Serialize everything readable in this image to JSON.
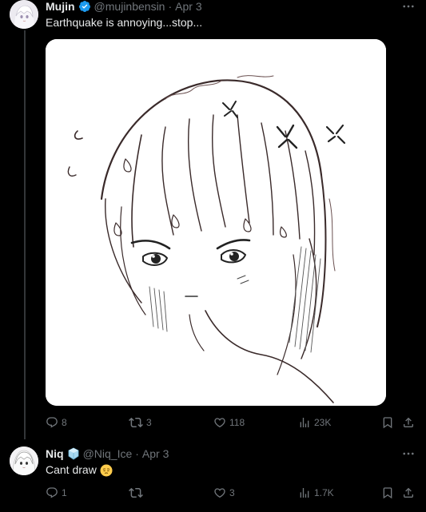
{
  "tweets": [
    {
      "author": {
        "name": "Mujin",
        "handle": "@mujinbensin",
        "verified": true,
        "avatar_icon": "anime-girl-avatar"
      },
      "separator": "·",
      "date": "Apr 3",
      "text": "Earthquake is annoying...stop...",
      "media": {
        "type": "image",
        "description_icon": "annoyed-anime-girl-sketch"
      },
      "actions": {
        "replies": "8",
        "reposts": "3",
        "likes": "118",
        "views": "23K"
      }
    },
    {
      "author": {
        "name": "Niq",
        "handle": "@Niq_Ice",
        "badge_icon": "ice-cube-icon",
        "avatar_icon": "anime-girl-avatar"
      },
      "separator": "·",
      "date": "Apr 3",
      "text": "Cant draw",
      "text_emoji_icon": "pensive-face-emoji",
      "actions": {
        "replies": "1",
        "reposts": "",
        "likes": "3",
        "views": "1.7K"
      }
    }
  ],
  "colors": {
    "background": "#000000",
    "text_primary": "#e7e9ea",
    "text_secondary": "#71767b",
    "verified_blue": "#1d9bf0",
    "thread_line": "#333639"
  }
}
